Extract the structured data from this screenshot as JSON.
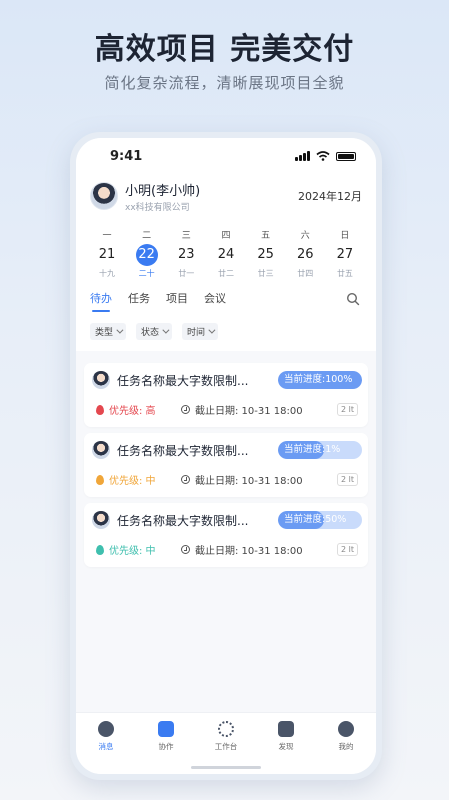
{
  "promo": {
    "headline": "高效项目 完美交付",
    "subline": "简化复杂流程，清晰展现项目全貌"
  },
  "status_bar": {
    "time": "9:41"
  },
  "profile": {
    "name": "小明(李小帅)",
    "company": "xx科技有限公司",
    "month": "2024年12月"
  },
  "calendar": {
    "days": [
      {
        "weekday": "一",
        "date": "21",
        "lunar": "十九",
        "active": false
      },
      {
        "weekday": "二",
        "date": "22",
        "lunar": "二十",
        "active": true
      },
      {
        "weekday": "三",
        "date": "23",
        "lunar": "廿一",
        "active": false
      },
      {
        "weekday": "四",
        "date": "24",
        "lunar": "廿二",
        "active": false
      },
      {
        "weekday": "五",
        "date": "25",
        "lunar": "廿三",
        "active": false
      },
      {
        "weekday": "六",
        "date": "26",
        "lunar": "廿四",
        "active": false
      },
      {
        "weekday": "日",
        "date": "27",
        "lunar": "廿五",
        "active": false
      }
    ]
  },
  "tabs": [
    {
      "label": "待办",
      "active": true
    },
    {
      "label": "任务",
      "active": false
    },
    {
      "label": "项目",
      "active": false
    },
    {
      "label": "会议",
      "active": false
    }
  ],
  "filters": [
    "类型",
    "状态",
    "时间"
  ],
  "tasks": [
    {
      "title": "任务名称最大字数限制...",
      "progress_label": "当前进度:100%",
      "progress": 1.0,
      "priority_label": "优先级: 高",
      "priority_color": "#e4484f",
      "deadline": "截止日期:  10-31 18:00",
      "count": "2 lt"
    },
    {
      "title": "任务名称最大字数限制...",
      "progress_label": "当前进度:1%",
      "progress": 0.01,
      "priority_label": "优先级: 中",
      "priority_color": "#f0a63a",
      "deadline": "截止日期:  10-31 18:00",
      "count": "2 lt"
    },
    {
      "title": "任务名称最大字数限制...",
      "progress_label": "当前进度:50%",
      "progress": 0.5,
      "priority_label": "优先级: 中",
      "priority_color": "#3fbfae",
      "deadline": "截止日期:  10-31 18:00",
      "count": "2 lt"
    }
  ],
  "bottom_nav": [
    {
      "label": "消息",
      "icon": "chat-icon",
      "color": "#4a5568",
      "active": true
    },
    {
      "label": "协作",
      "icon": "collab-icon",
      "color": "#3a7bf1",
      "active": false
    },
    {
      "label": "工作台",
      "icon": "workbench-icon",
      "color": "#4a5568",
      "active": false
    },
    {
      "label": "发现",
      "icon": "discover-icon",
      "color": "#4a5568",
      "active": false
    },
    {
      "label": "我的",
      "icon": "profile-icon",
      "color": "#4a5568",
      "active": false
    }
  ],
  "colors": {
    "accent": "#3a7bf1"
  }
}
